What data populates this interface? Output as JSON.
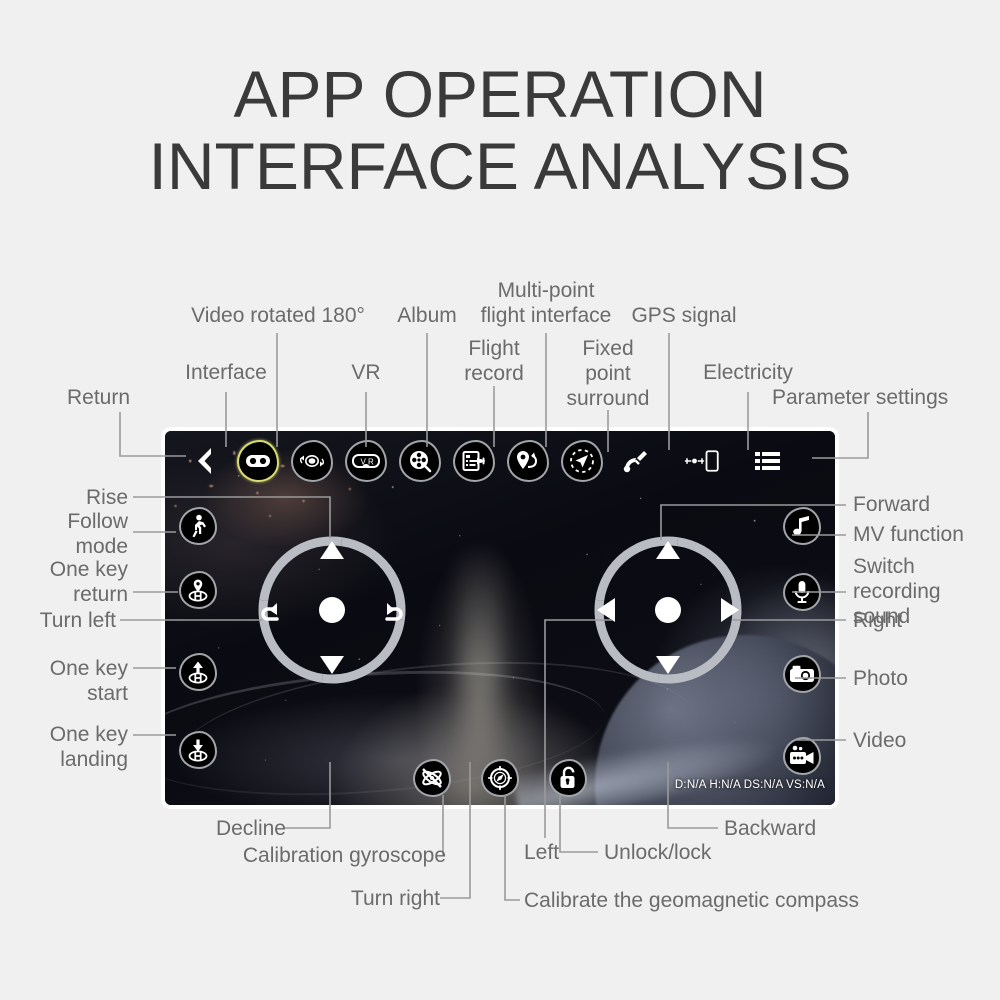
{
  "title": "APP OPERATION\nINTERFACE ANALYSIS",
  "screen": {
    "telemetry": "D:N/A H:N/A DS:N/A VS:N/A",
    "accent_highlight": "#d9dc72",
    "label_color": "#6b6b6b",
    "page_background": "#f0f0f0",
    "bezel_color": "#ffffff"
  },
  "toolbar": {
    "items": [
      {
        "icon": "back-chevron-icon",
        "label": "Return",
        "highlighted": false,
        "framed": false
      },
      {
        "icon": "gamepad-icon",
        "label": "Interface",
        "highlighted": true,
        "framed": true
      },
      {
        "icon": "video-rotate-180-icon",
        "label": "Video rotated 180°",
        "highlighted": false,
        "framed": true
      },
      {
        "icon": "vr-goggles-icon",
        "label": "VR",
        "highlighted": false,
        "framed": true
      },
      {
        "icon": "album-film-icon",
        "label": "Album",
        "highlighted": false,
        "framed": true
      },
      {
        "icon": "flight-record-icon",
        "label": "Flight\nrecord",
        "highlighted": false,
        "framed": true
      },
      {
        "icon": "multi-point-flight-icon",
        "label": "Multi-point\nflight interface",
        "highlighted": false,
        "framed": true
      },
      {
        "icon": "fixed-point-surround-icon",
        "label": "Fixed\npoint\nsurround",
        "highlighted": false,
        "framed": true
      },
      {
        "icon": "gps-satellite-icon",
        "label": "GPS signal",
        "highlighted": false,
        "framed": false
      },
      {
        "icon": "battery-drone-icon",
        "label": "Electricity",
        "highlighted": false,
        "framed": false
      },
      {
        "icon": "parameter-list-icon",
        "label": "Parameter settings",
        "highlighted": false,
        "framed": false
      }
    ]
  },
  "left_buttons": [
    {
      "icon": "follow-mode-walker-icon",
      "label": "Follow\nmode"
    },
    {
      "icon": "one-key-return-home-icon",
      "label": "One key\nreturn"
    },
    {
      "icon": "one-key-takeoff-icon",
      "label": "One key\nstart"
    },
    {
      "icon": "one-key-landing-icon",
      "label": "One key\nlanding"
    }
  ],
  "right_buttons": [
    {
      "icon": "music-note-icon",
      "label": "MV function"
    },
    {
      "icon": "microphone-icon",
      "label": "Switch\nrecording\nsound"
    },
    {
      "icon": "camera-photo-icon",
      "label": "Photo"
    },
    {
      "icon": "video-camera-icon",
      "label": "Video"
    }
  ],
  "bottom_buttons": [
    {
      "icon": "gyroscope-calibration-icon",
      "label": "Calibration gyroscope"
    },
    {
      "icon": "compass-calibration-icon",
      "label": "Calibrate the geomagnetic compass"
    },
    {
      "icon": "unlock-padlock-icon",
      "label": "Unlock/lock"
    }
  ],
  "left_stick": {
    "name": "left-virtual-joystick",
    "up": "Rise",
    "down": "Decline",
    "left": "Turn left",
    "right": "Turn right"
  },
  "right_stick": {
    "name": "right-virtual-joystick",
    "up": "Forward",
    "down": "Backward",
    "left": "Left",
    "right": "Right"
  }
}
